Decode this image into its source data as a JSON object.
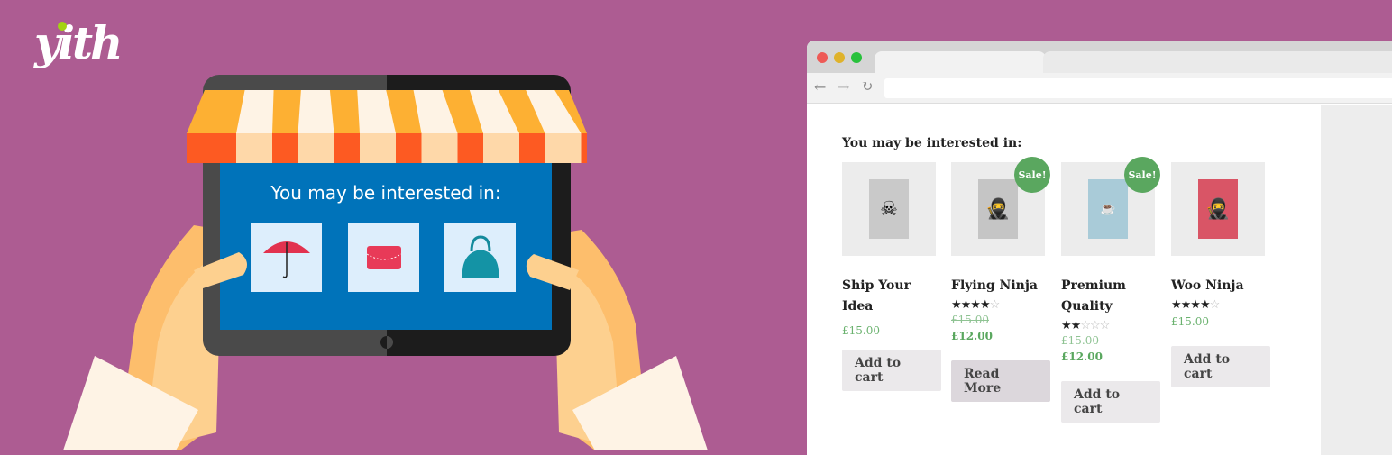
{
  "logo": {
    "text": "yith"
  },
  "tablet": {
    "title": "You may be interested in:",
    "items": [
      "umbrella",
      "clutch-bag",
      "handbag"
    ]
  },
  "colors": {
    "background": "#ad5c92",
    "screen": "#0073ba",
    "sale": "#5aa75f",
    "price": "#5aa75f"
  },
  "browser": {
    "section_title": "You may be interested in:",
    "products": [
      {
        "name": "Ship Your Idea",
        "rating": null,
        "old_price": null,
        "price": "£15.00",
        "sale": null,
        "button": "Add to cart"
      },
      {
        "name": "Flying Ninja",
        "rating": 4,
        "old_price": "£15.00",
        "price": "£12.00",
        "sale": "Sale!",
        "button": "Read More"
      },
      {
        "name": "Premium Quality",
        "rating": 2,
        "old_price": "£15.00",
        "price": "£12.00",
        "sale": "Sale!",
        "button": "Add to cart"
      },
      {
        "name": "Woo Ninja",
        "rating": 4,
        "old_price": null,
        "price": "£15.00",
        "sale": null,
        "button": "Add to cart"
      }
    ]
  }
}
